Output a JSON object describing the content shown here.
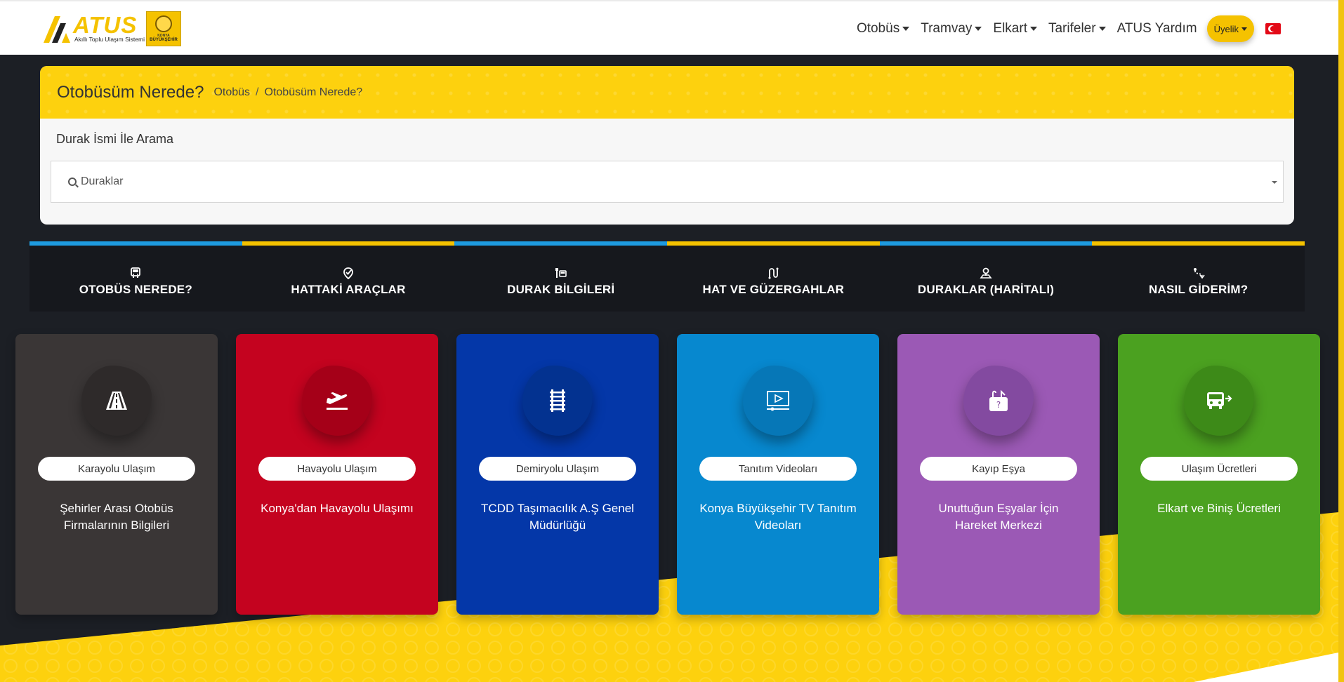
{
  "header": {
    "brand_name": "ATUS",
    "brand_sub": "Akıllı Toplu Ulaşım Sistemi",
    "municipality_line1": "KONYA",
    "municipality_line2": "BÜYÜKŞEHİR",
    "nav": [
      {
        "label": "Otobüs",
        "dropdown": true
      },
      {
        "label": "Tramvay",
        "dropdown": true
      },
      {
        "label": "Elkart",
        "dropdown": true
      },
      {
        "label": "Tarifeler",
        "dropdown": true
      },
      {
        "label": "ATUS Yardım",
        "dropdown": false
      }
    ],
    "membership_label": "Üyelik",
    "language_flag": "tr-flag-icon"
  },
  "search_panel": {
    "title": "Otobüsüm Nerede?",
    "breadcrumb": [
      "Otobüs",
      "Otobüsüm Nerede?"
    ],
    "breadcrumb_sep": "/",
    "search_label": "Durak İsmi İle Arama",
    "search_placeholder": "Duraklar"
  },
  "quick_tabs": [
    {
      "label": "OTOBÜS NEREDE?",
      "icon": "bus-icon"
    },
    {
      "label": "HATTAKİ ARAÇLAR",
      "icon": "location-check-icon"
    },
    {
      "label": "DURAK BİLGİLERİ",
      "icon": "bus-stop-icon"
    },
    {
      "label": "HAT VE GÜZERGAHLAR",
      "icon": "route-icon"
    },
    {
      "label": "DURAKLAR (HARİTALI)",
      "icon": "map-pin-icon"
    },
    {
      "label": "NASIL GİDERİM?",
      "icon": "directions-icon"
    }
  ],
  "cards": [
    {
      "title": "Karayolu Ulaşım",
      "desc": "Şehirler Arası Otobüs Firmalarının Bilgileri",
      "color": "#3a3636",
      "blob": "#2e2a2a",
      "icon": "road-icon"
    },
    {
      "title": "Havayolu Ulaşım",
      "desc": "Konya'dan Havayolu Ulaşımı",
      "color": "#c4031f",
      "blob": "#a50018",
      "icon": "plane-takeoff-icon"
    },
    {
      "title": "Demiryolu Ulaşım",
      "desc": "TCDD Taşımacılık A.Ş Genel Müdürlüğü",
      "color": "#0437a8",
      "blob": "#033290",
      "icon": "railway-icon"
    },
    {
      "title": "Tanıtım Videoları",
      "desc": "Konya Büyükşehir TV Tanıtım Videoları",
      "color": "#0788cf",
      "blob": "#0677b7",
      "icon": "video-icon"
    },
    {
      "title": "Kayıp Eşya",
      "desc": "Unuttuğun Eşyalar İçin Hareket Merkezi",
      "color": "#9b59b5",
      "blob": "#834aa0",
      "icon": "lost-box-icon"
    },
    {
      "title": "Ulaşım Ücretleri",
      "desc": "Elkart ve Biniş Ücretleri",
      "color": "#4ba120",
      "blob": "#3d8a18",
      "icon": "bus-fare-icon"
    }
  ]
}
